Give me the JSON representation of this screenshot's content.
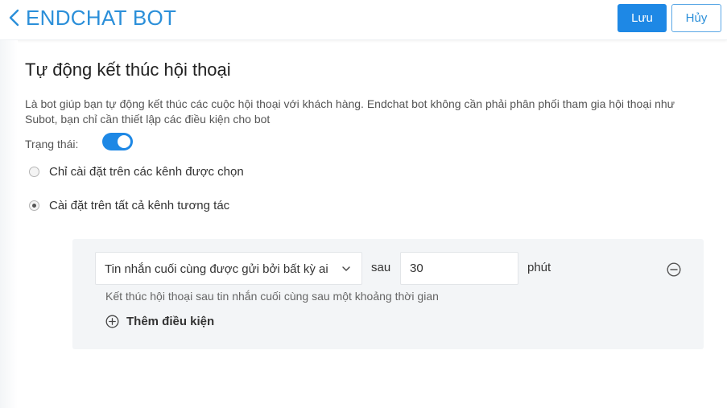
{
  "header": {
    "title": "ENDCHAT BOT",
    "save_label": "Lưu",
    "cancel_label": "Hủy",
    "accent": "#1e88e5"
  },
  "main": {
    "title": "Tự động kết thúc hội thoại",
    "description": "Là bot giúp bạn tự động kết thúc các cuộc hội thoại với khách hàng. Endchat bot không cần phải phân phối tham gia hội thoại như Subot, bạn chỉ cần thiết lập các điều kiện cho bot",
    "status_label": "Trạng thái:",
    "status_on": true,
    "scope_options": [
      {
        "label": "Chỉ cài đặt trên các kênh được chọn",
        "checked": false
      },
      {
        "label": "Cài đặt trên tất cả kênh tương tác",
        "checked": true
      }
    ]
  },
  "condition": {
    "select_value": "Tin nhắn cuối cùng được gửi bởi bất kỳ ai",
    "after_label": "sau",
    "minutes_value": "30",
    "unit_label": "phút",
    "hint": "Kết thúc hội thoại sau tin nhắn cuối cùng sau một khoảng thời gian",
    "add_label": "Thêm điều kiện"
  }
}
